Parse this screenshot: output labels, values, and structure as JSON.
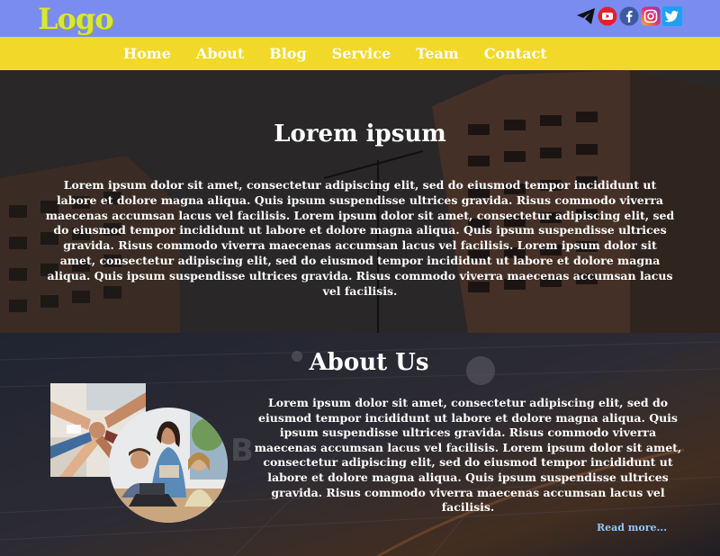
{
  "header": {
    "logo_text": "Logo",
    "social_icons": [
      "telegram-icon",
      "youtube-icon",
      "facebook-icon",
      "instagram-icon",
      "twitter-icon"
    ]
  },
  "nav": {
    "items": [
      "Home",
      "About",
      "Blog",
      "Service",
      "Team",
      "Contact"
    ]
  },
  "hero": {
    "title": "Lorem ipsum",
    "text": "Lorem ipsum dolor sit amet, consectetur adipiscing elit, sed do eiusmod tempor incididunt ut labore et dolore magna aliqua. Quis ipsum suspendisse ultrices gravida. Risus commodo viverra maecenas accumsan lacus vel facilisis. Lorem ipsum dolor sit amet, consectetur adipiscing elit, sed do eiusmod tempor incididunt ut labore et dolore magna aliqua. Quis ipsum suspendisse ultrices gravida. Risus commodo viverra maecenas accumsan lacus vel facilisis. Lorem ipsum dolor sit amet, consectetur adipiscing elit, sed do eiusmod tempor incididunt ut labore et dolore magna aliqua. Quis ipsum suspendisse ultrices gravida. Risus commodo viverra maecenas accumsan lacus vel facilisis."
  },
  "about": {
    "title": "About Us",
    "text": "Lorem ipsum dolor sit amet, consectetur adipiscing elit, sed do eiusmod tempor incididunt ut labore et dolore magna aliqua. Quis ipsum suspendisse ultrices gravida. Risus commodo viverra maecenas accumsan lacus vel facilisis. Lorem ipsum dolor sit amet, consectetur adipiscing elit, sed do eiusmod tempor incididunt ut labore et dolore magna aliqua. Quis ipsum suspendisse ultrices gravida. Risus commodo viverra maecenas accumsan lacus vel facilisis.",
    "read_more": "Read more..."
  },
  "colors": {
    "topbar": "#7b8cf0",
    "nav": "#f2d829",
    "logo": "#d8e63a",
    "link": "#8fc6ff"
  }
}
